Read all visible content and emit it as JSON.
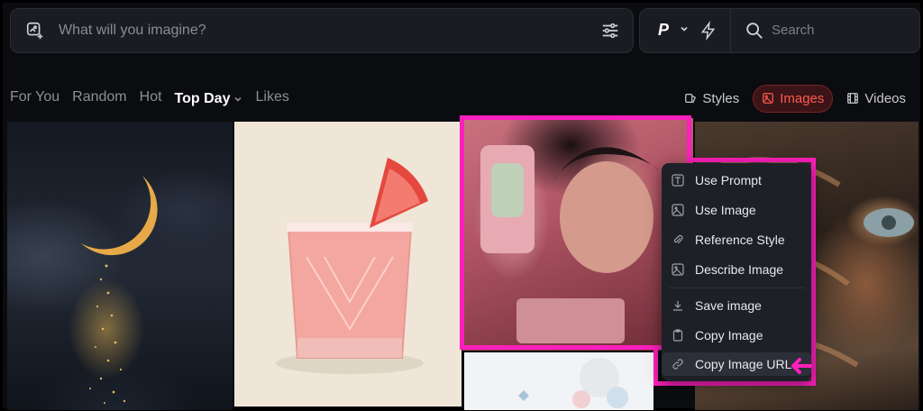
{
  "top": {
    "prompt_placeholder": "What will you imagine?",
    "model_label": "P",
    "search_placeholder": "Search"
  },
  "nav": {
    "tabs": [
      "For You",
      "Random",
      "Hot",
      "Top Day",
      "Likes"
    ],
    "active_index": 3
  },
  "types": {
    "styles": "Styles",
    "images": "Images",
    "videos": "Videos"
  },
  "menu": {
    "items": [
      {
        "label": "Use Prompt",
        "icon": "text-icon"
      },
      {
        "label": "Use Image",
        "icon": "image-icon"
      },
      {
        "label": "Reference Style",
        "icon": "paperclip-icon"
      },
      {
        "label": "Describe Image",
        "icon": "image-icon"
      },
      {
        "label": "Save image",
        "icon": "download-icon"
      },
      {
        "label": "Copy Image",
        "icon": "clipboard-icon"
      },
      {
        "label": "Copy Image URL",
        "icon": "link-icon"
      }
    ]
  },
  "colors": {
    "highlight": "#ff1fbd",
    "accent": "#ff5a4e"
  }
}
